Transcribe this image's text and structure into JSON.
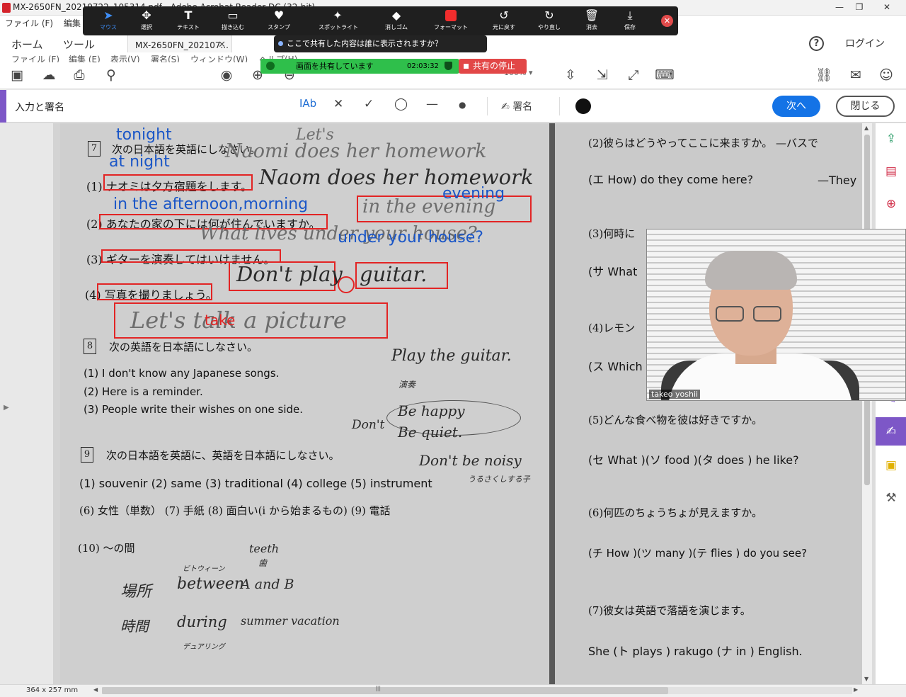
{
  "window": {
    "title": "MX-2650FN_20210722_105314.pdf - Adobe Acrobat Reader DC (32-bit)",
    "min": "—",
    "restore": "❐",
    "close": "✕"
  },
  "menubar": {
    "file": "ファイル (F)",
    "edit": "編集"
  },
  "zoom_toolbar": {
    "items": [
      {
        "icon": "cursor",
        "glyph": "➤",
        "label": "マウス"
      },
      {
        "icon": "move",
        "glyph": "✥",
        "label": "選択"
      },
      {
        "icon": "text",
        "glyph": "T",
        "label": "テキスト"
      },
      {
        "icon": "draw",
        "glyph": "▭",
        "label": "描き込む"
      },
      {
        "icon": "stamp",
        "glyph": "♥",
        "label": "スタンプ"
      },
      {
        "icon": "spotlight",
        "glyph": "✦",
        "label": "スポットライト"
      },
      {
        "icon": "eraser",
        "glyph": "◆",
        "label": "消しゴム"
      },
      {
        "icon": "format",
        "glyph": "",
        "label": "フォーマット"
      },
      {
        "icon": "undo",
        "glyph": "↺",
        "label": "元に戻す"
      },
      {
        "icon": "redo",
        "glyph": "↻",
        "label": "やり直し"
      },
      {
        "icon": "trash",
        "glyph": "🗑",
        "label": "消去"
      },
      {
        "icon": "save",
        "glyph": "⤓",
        "label": "保存"
      }
    ],
    "close": "✕"
  },
  "tabs": {
    "home": "ホーム",
    "tools": "ツール",
    "document_tab": "MX-2650FN_202107...",
    "tab_close": "✕",
    "help": "?",
    "login": "ログイン"
  },
  "share_question": "ここで共有した内容は誰に表示されますか？",
  "menu2": {
    "file": "ファイル (F)",
    "edit": "編集 (E)",
    "view": "表示(V)",
    "sign": "署名(S)",
    "window": "ウィンドウ(W)",
    "help": "ヘルプ(H)"
  },
  "sharing_banner": {
    "text": "画面を共有しています",
    "time": "02:03:32",
    "stop": "共有の停止"
  },
  "toolbar": {
    "zoom": "100%"
  },
  "signbar": {
    "title": "入力と署名",
    "text_tool": "IAb",
    "cross": "✕",
    "check": "✓",
    "circle": "◯",
    "line": "—",
    "dot": "●",
    "sign": "署名",
    "next": "次へ",
    "close": "閉じる"
  },
  "worksheet_left": {
    "sec7_num": "7",
    "sec7_title": "次の日本語を英語にしなさい。",
    "q1": "(1) ナオミは夕方宿題をします。",
    "q2": "(2) あなたの家の下には何が住んでいますか。",
    "q3": "(3) ギターを演奏してはいけません。",
    "q4": "(4) 写真を撮りましょう。",
    "sec8_num": "8",
    "sec8_title": "次の英語を日本語にしなさい。",
    "s8_1": "(1) I don't know any Japanese songs.",
    "s8_2": "(2) Here is a reminder.",
    "s8_3": "(3) People write their wishes on one side.",
    "sec9_num": "9",
    "sec9_title": "次の日本語を英語に、英語を日本語にしなさい。",
    "s9_row1": "(1) souvenir   (2) same   (3) traditional   (4) college   (5) instrument",
    "s9_row2": "(6) 女性（単数）   (7) 手紙   (8) 面白い(i から始まるもの)   (9) 電話",
    "s9_10": "(10) ～の間"
  },
  "handwriting_left": {
    "lets": "Let's",
    "naomi1": "Naomi does her homework",
    "naomi2": "Naom does her homework",
    "evening": "in the evening",
    "what_lives": "What lives under your house?",
    "dont_play": "Don't play",
    "guitar": "guitar.",
    "lets_take": "Let's talk a picture",
    "play_the_guitar": "Play the guitar.",
    "ensou": "演奏",
    "be_happy": "Be happy",
    "be_quiet": "Be quiet.",
    "dont": "Don't",
    "dont_be_noisy": "Don't be noisy",
    "teeth": "teeth",
    "between": "between",
    "a_and_b": "A and B",
    "during": "during",
    "summer_vacation": "summer vacation",
    "basho": "場所",
    "jikan": "時間",
    "ha": "歯",
    "bitowiin": "ビトウィーン",
    "dyuaring": "デュアリング",
    "kotoba_hint": "うるさくしする子"
  },
  "annotations": {
    "tonight": "tonight",
    "at_night": "at night",
    "afternoon": "in the afternoon,morning",
    "evening": "evening",
    "under_house": "under your house?",
    "take": "take"
  },
  "worksheet_right": {
    "r2": "(2)彼らはどうやってここに来ますか。 —バスで",
    "r2_ans": "(エ How) do they come here?",
    "r2_they": "—They",
    "r3": "(3)何時に",
    "r3_ans": "(サ What",
    "r4": "(4)レモン",
    "r4_ans": "(ス Which",
    "r5": "(5)どんな食べ物を彼は好きですか。",
    "r5_ans": "(セ What )(ソ food )(タ does ) he like?",
    "r6": "(6)何匹のちょうちょが見えますか。",
    "r6_ans": "(チ How )(ツ many )(テ flies ) do you see?",
    "r7": "(7)彼女は英語で落語を演じます。",
    "r7_ans": "She (ト plays ) rakugo (ナ in ) English."
  },
  "video": {
    "name": "takeo yoshii"
  },
  "statusbar": {
    "dims": "364 x 257 mm",
    "grip": "|||"
  },
  "right_panel": {
    "icons": [
      "export-pdf-icon",
      "organize-icon",
      "create-pdf-icon",
      "edit-icon",
      "fill-sign-icon",
      "comment-icon",
      "more-tools-icon"
    ],
    "glyphs": [
      "⇪",
      "▤",
      "⊕",
      "✎",
      "✍",
      "▣",
      "⚒"
    ]
  },
  "colors": {
    "accent": "#7d57c7",
    "adobe_blue": "#1473e6",
    "annotation_blue": "#1a56c7",
    "annotation_red": "#e22424",
    "share_green": "#2fbf4b"
  }
}
